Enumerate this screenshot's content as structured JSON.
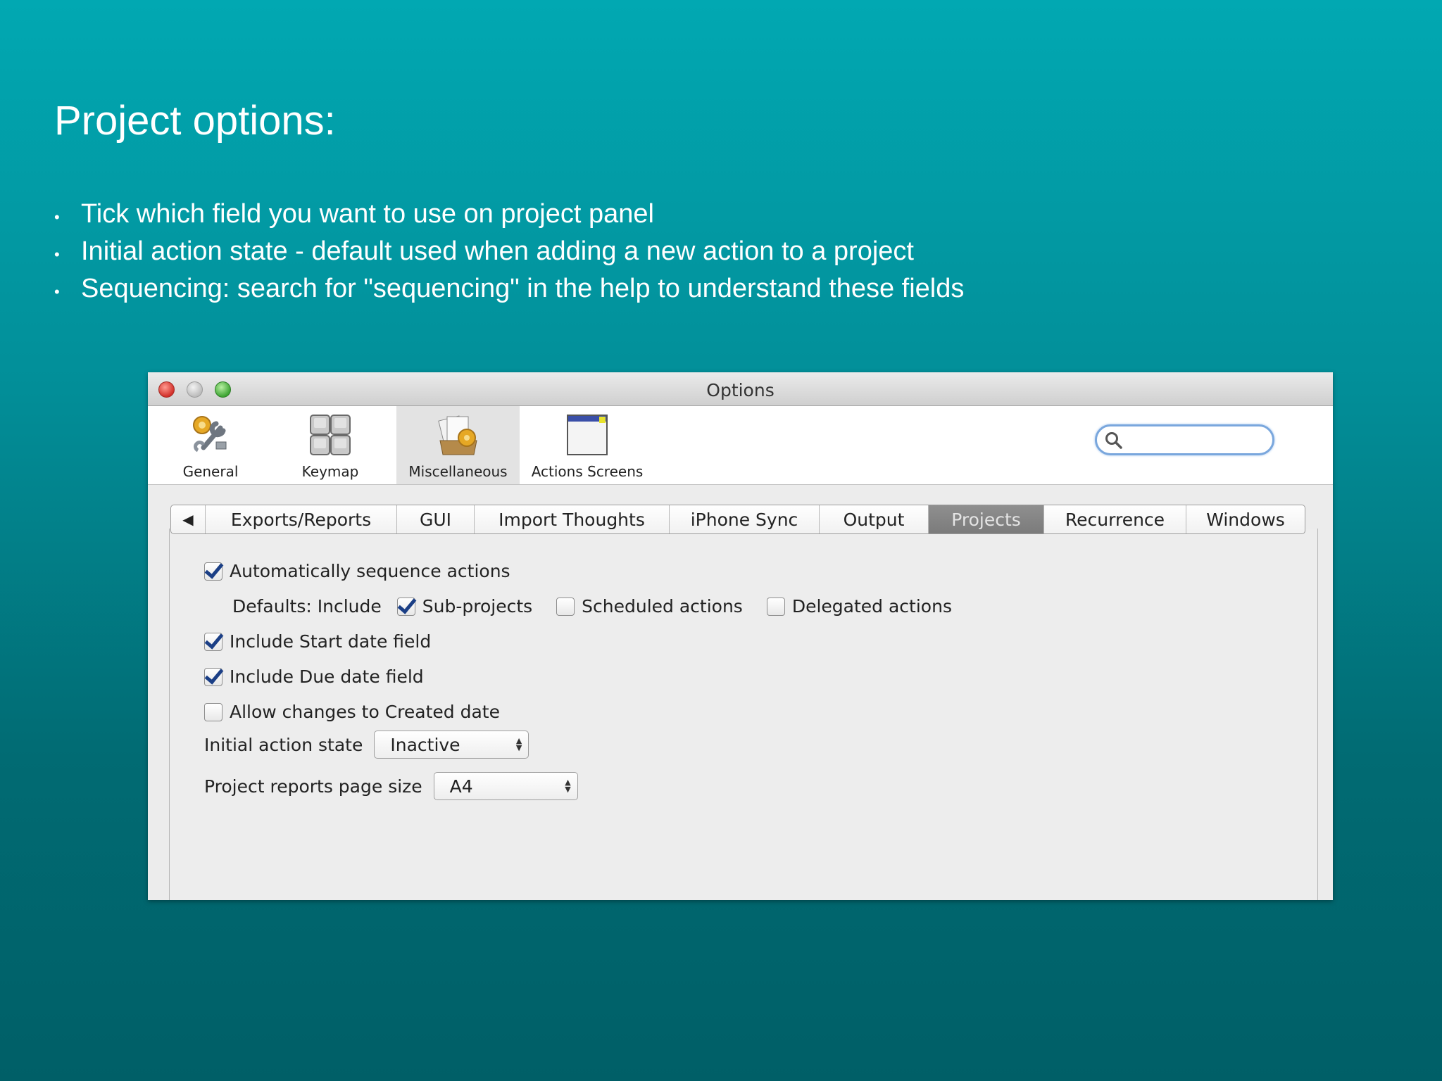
{
  "slide": {
    "title": "Project options:",
    "bullets": [
      "Tick which field you want to use on project panel",
      "Initial action state - default used when adding a new action to a project",
      "Sequencing: search for \"sequencing\" in the help to understand these fields"
    ]
  },
  "window": {
    "title": "Options",
    "toolbar": {
      "items": [
        {
          "label": "General",
          "icon": "general-icon"
        },
        {
          "label": "Keymap",
          "icon": "keymap-icon"
        },
        {
          "label": "Miscellaneous",
          "icon": "miscellaneous-icon",
          "selected": true
        },
        {
          "label": "Actions Screens",
          "icon": "actions-screens-icon"
        }
      ],
      "search": {
        "value": "",
        "placeholder": ""
      }
    },
    "tabs": {
      "scroll_left_glyph": "◀",
      "items": [
        "Exports/Reports",
        "GUI",
        "Import Thoughts",
        "iPhone Sync",
        "Output",
        "Projects",
        "Recurrence",
        "Windows"
      ],
      "active": "Projects"
    },
    "projects": {
      "auto_sequence": {
        "label": "Automatically sequence actions",
        "checked": true
      },
      "defaults_label": "Defaults: Include",
      "sub_projects": {
        "label": "Sub-projects",
        "checked": true
      },
      "scheduled_actions": {
        "label": "Scheduled actions",
        "checked": false
      },
      "delegated_actions": {
        "label": "Delegated actions",
        "checked": false
      },
      "start_date": {
        "label": "Include Start date field",
        "checked": true
      },
      "due_date": {
        "label": "Include Due date field",
        "checked": true
      },
      "created_date": {
        "label": "Allow changes to Created date",
        "checked": false
      },
      "initial_action_state": {
        "label": "Initial action state",
        "value": "Inactive"
      },
      "page_size": {
        "label": "Project reports page size",
        "value": "A4"
      }
    }
  },
  "colors": {
    "background_top": "#01a8b2",
    "background_bottom": "#005f67",
    "active_tab": "#858585",
    "checkmark": "#1b3f86"
  }
}
